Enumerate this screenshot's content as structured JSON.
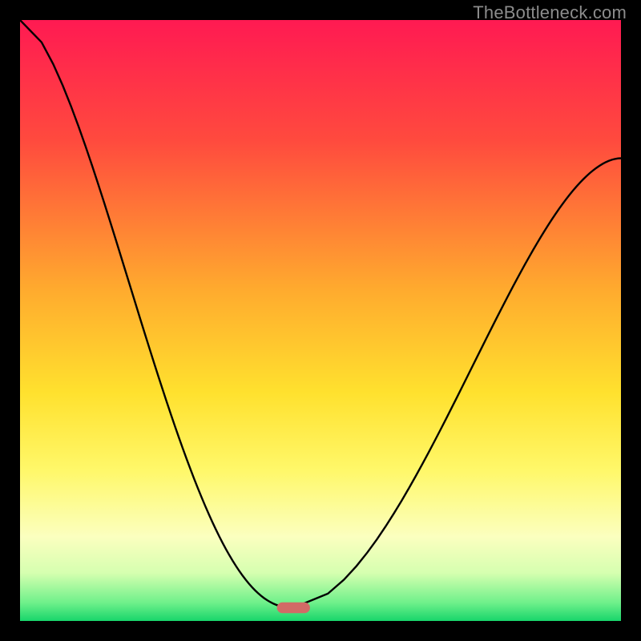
{
  "watermark": "TheBottleneck.com",
  "chart_data": {
    "type": "line",
    "title": "",
    "xlabel": "",
    "ylabel": "",
    "xlim": [
      0,
      100
    ],
    "ylim": [
      0,
      100
    ],
    "gradient_stops": [
      {
        "offset": 0,
        "color": "#ff1a52"
      },
      {
        "offset": 20,
        "color": "#ff4a3e"
      },
      {
        "offset": 45,
        "color": "#ffab2e"
      },
      {
        "offset": 62,
        "color": "#ffe12e"
      },
      {
        "offset": 75,
        "color": "#fff86a"
      },
      {
        "offset": 86,
        "color": "#fbffbf"
      },
      {
        "offset": 92,
        "color": "#d6ffb0"
      },
      {
        "offset": 97,
        "color": "#6ef08a"
      },
      {
        "offset": 100,
        "color": "#18d56b"
      }
    ],
    "series": [
      {
        "name": "bottleneck-curve",
        "type": "cusp",
        "cusp_x": 45.5,
        "cusp_y": 97.8,
        "left_start": {
          "x": 0,
          "y": 0
        },
        "right_end": {
          "x": 100,
          "y": 23
        }
      }
    ],
    "marker": {
      "shape": "pill",
      "x": 45.5,
      "y": 97.8,
      "width": 5.5,
      "height": 1.8,
      "color": "#d26a66"
    }
  }
}
